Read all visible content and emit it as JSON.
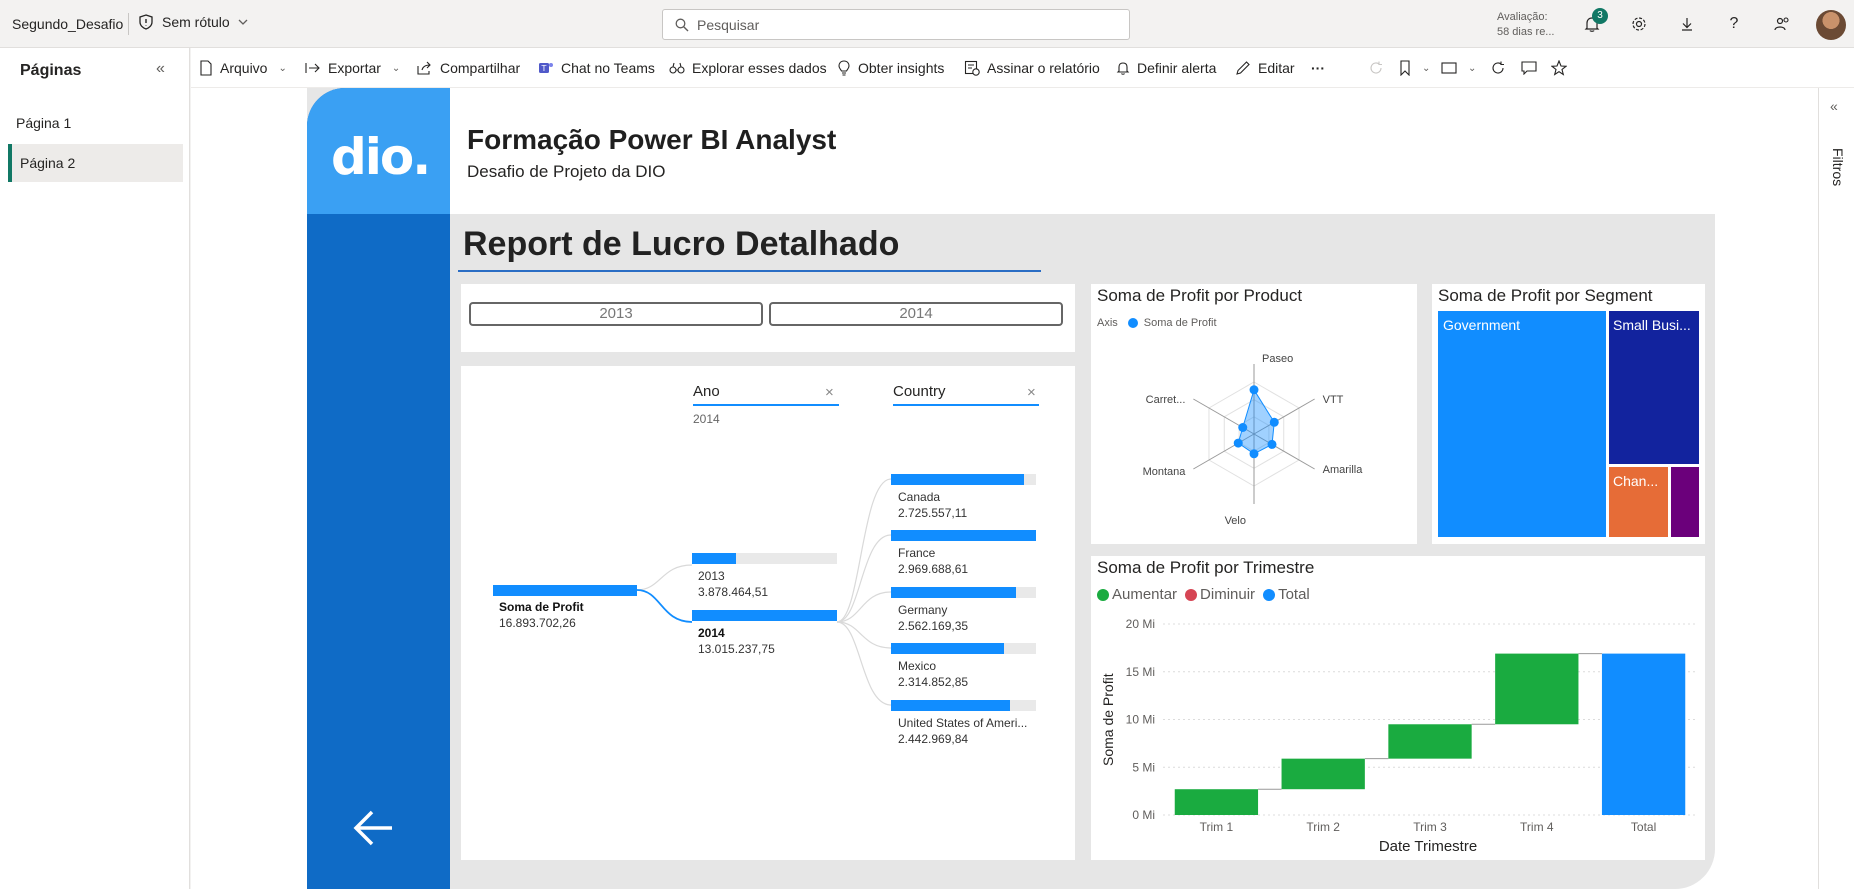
{
  "topbar": {
    "workspace": "Segundo_Desafio",
    "sensitivity": "Sem rótulo",
    "search_placeholder": "Pesquisar",
    "trial_line1": "Avaliação:",
    "trial_line2": "58 dias re...",
    "notification_count": "3"
  },
  "pages": {
    "title": "Páginas",
    "items": [
      "Página 1",
      "Página 2"
    ],
    "active_index": 1
  },
  "commands": {
    "file": "Arquivo",
    "export": "Exportar",
    "share": "Compartilhar",
    "teams": "Chat no Teams",
    "explore": "Explorar esses dados",
    "insights": "Obter insights",
    "subscribe": "Assinar o relatório",
    "alert": "Definir alerta",
    "edit": "Editar",
    "more": "···"
  },
  "filters_pane": {
    "label": "Filtros"
  },
  "report": {
    "logo_text": "dio.",
    "title": "Formação Power BI Analyst",
    "subtitle": "Desafio de Projeto da DIO",
    "page_title": "Report de Lucro Detalhado",
    "year_slicer": [
      "2013",
      "2014"
    ],
    "decomp": {
      "level_ano": "Ano",
      "level_ano_value": "2014",
      "level_country": "Country",
      "root_label": "Soma de Profit",
      "root_value": "16.893.702,26",
      "years": [
        {
          "label": "2013",
          "value": "3.878.464,51",
          "fill": 0.3
        },
        {
          "label": "2014",
          "value": "13.015.237,75",
          "fill": 1.0
        }
      ],
      "countries": [
        {
          "label": "Canada",
          "value": "2.725.557,11",
          "fill": 0.92
        },
        {
          "label": "France",
          "value": "2.969.688,61",
          "fill": 1.0
        },
        {
          "label": "Germany",
          "value": "2.562.169,35",
          "fill": 0.86
        },
        {
          "label": "Mexico",
          "value": "2.314.852,85",
          "fill": 0.78
        },
        {
          "label": "United States of Ameri...",
          "value": "2.442.969,84",
          "fill": 0.82
        }
      ]
    },
    "radar": {
      "title": "Soma de Profit por Product",
      "legend_axis": "Axis",
      "legend_series": "Soma de Profit",
      "products": [
        "Paseo",
        "VTT",
        "Amarilla",
        "Velo",
        "Montana",
        "Carret..."
      ],
      "values": [
        0.85,
        0.45,
        0.4,
        0.38,
        0.35,
        0.25
      ]
    },
    "treemap": {
      "title": "Soma de Profit por Segment",
      "segments": [
        {
          "label": "Government",
          "color": "#118dff"
        },
        {
          "label": "Small Busi...",
          "color": "#12239e"
        },
        {
          "label": "Chan...",
          "color": "#e66c37"
        },
        {
          "label": "",
          "color": "#6b007b"
        }
      ]
    },
    "waterfall": {
      "title": "Soma de Profit por Trimestre",
      "legend": [
        {
          "label": "Aumentar",
          "color": "#1aab40"
        },
        {
          "label": "Diminuir",
          "color": "#d64554"
        },
        {
          "label": "Total",
          "color": "#118dff"
        }
      ],
      "ylabel": "Soma de Profit",
      "xlabel": "Date Trimestre",
      "yticks": [
        "0 Mi",
        "5 Mi",
        "10 Mi",
        "15 Mi",
        "20 Mi"
      ]
    }
  },
  "chart_data": {
    "type": "bar",
    "title": "Soma de Profit por Trimestre",
    "xlabel": "Date Trimestre",
    "ylabel": "Soma de Profit",
    "categories": [
      "Trim 1",
      "Trim 2",
      "Trim 3",
      "Trim 4",
      "Total"
    ],
    "series": [
      {
        "name": "Aumentar",
        "values": [
          2.7,
          3.2,
          3.6,
          7.4,
          null
        ]
      },
      {
        "name": "Total",
        "values": [
          null,
          null,
          null,
          null,
          16.9
        ]
      }
    ],
    "ylim": [
      0,
      20
    ],
    "unit": "Mi",
    "grid": true,
    "legend": "top-left"
  }
}
